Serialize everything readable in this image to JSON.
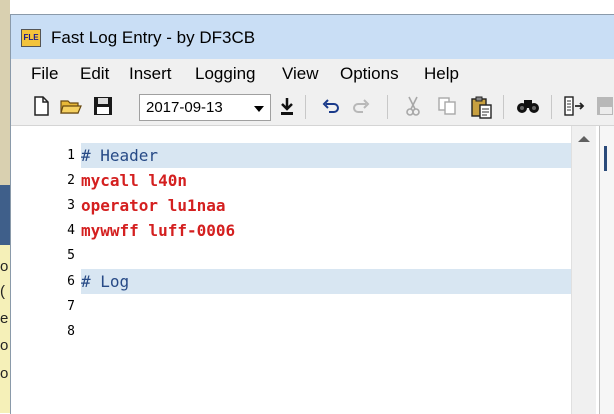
{
  "background": {
    "edge_letters": [
      "o",
      "(",
      "e",
      "o",
      "o"
    ]
  },
  "window": {
    "icon_text": "FLE",
    "title": "Fast Log Entry - by DF3CB"
  },
  "menu": {
    "items": [
      "File",
      "Edit",
      "Insert",
      "Logging",
      "View",
      "Options",
      "Help"
    ]
  },
  "toolbar": {
    "date_value": "2017-09-13",
    "icons": [
      "new-file-icon",
      "open-folder-icon",
      "save-icon",
      "download-icon",
      "undo-icon",
      "redo-icon",
      "cut-icon",
      "copy-icon",
      "paste-icon",
      "find-icon",
      "qso-icon"
    ]
  },
  "editor": {
    "lines": [
      {
        "num": "1",
        "text": "# Header"
      },
      {
        "num": "2",
        "text": "mycall l40n"
      },
      {
        "num": "3",
        "text": "operator lu1naa"
      },
      {
        "num": "4",
        "text": "mywwff luff-0006"
      },
      {
        "num": "5",
        "text": ""
      },
      {
        "num": "6",
        "text": "# Log"
      },
      {
        "num": "7",
        "text": ""
      },
      {
        "num": "8",
        "text": ""
      }
    ]
  },
  "colors": {
    "comment": "#274a86",
    "keyword": "#d42020",
    "line_highlight": "#d8e6f2",
    "titlebar": "#c9def5"
  }
}
